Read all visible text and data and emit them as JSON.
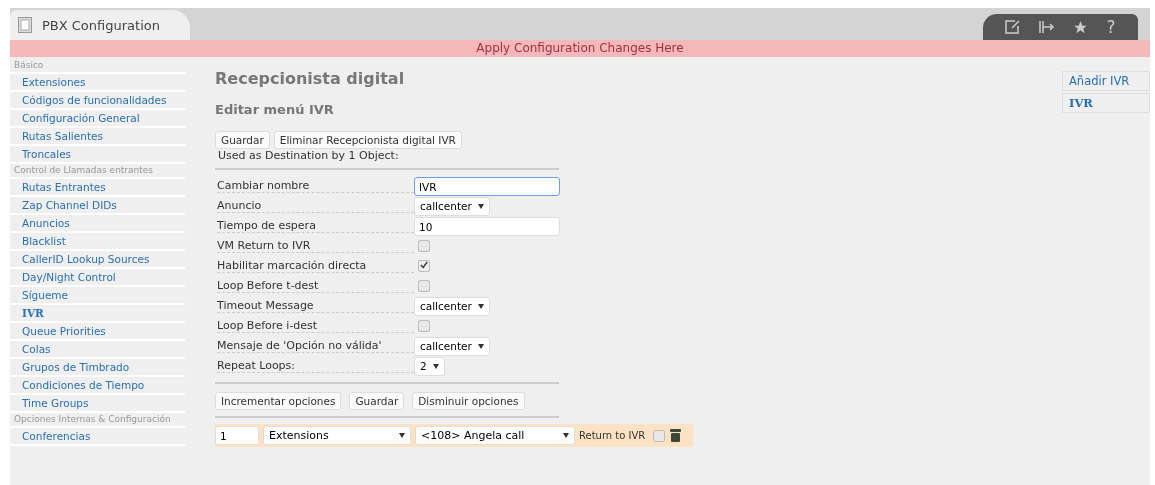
{
  "window": {
    "tab_title": "PBX Configuration",
    "help": "?"
  },
  "banner": "Apply Configuration Changes Here",
  "sidebar": {
    "items": [
      {
        "kind": "header",
        "label": "Básico"
      },
      {
        "kind": "link",
        "label": "Extensiones",
        "selected": false
      },
      {
        "kind": "link",
        "label": "Códigos de funcionalidades",
        "selected": false
      },
      {
        "kind": "link",
        "label": "Configuración General",
        "selected": false
      },
      {
        "kind": "link",
        "label": "Rutas Salientes",
        "selected": false
      },
      {
        "kind": "link",
        "label": "Troncales",
        "selected": false
      },
      {
        "kind": "header",
        "label": "Control de Llamadas entrantes"
      },
      {
        "kind": "link",
        "label": "Rutas Entrantes",
        "selected": false
      },
      {
        "kind": "link",
        "label": "Zap Channel DIDs",
        "selected": false
      },
      {
        "kind": "link",
        "label": "Anuncios",
        "selected": false
      },
      {
        "kind": "link",
        "label": "Blacklist",
        "selected": false
      },
      {
        "kind": "link",
        "label": "CallerID Lookup Sources",
        "selected": false
      },
      {
        "kind": "link",
        "label": "Day/Night Control",
        "selected": false
      },
      {
        "kind": "link",
        "label": "Sígueme",
        "selected": false
      },
      {
        "kind": "link",
        "label": "IVR",
        "selected": true
      },
      {
        "kind": "link",
        "label": "Queue Priorities",
        "selected": false
      },
      {
        "kind": "link",
        "label": "Colas",
        "selected": false
      },
      {
        "kind": "link",
        "label": "Grupos de Timbrado",
        "selected": false
      },
      {
        "kind": "link",
        "label": "Condiciones de Tiempo",
        "selected": false
      },
      {
        "kind": "link",
        "label": "Time Groups",
        "selected": false
      },
      {
        "kind": "header",
        "label": "Opciones Internas & Configuración"
      },
      {
        "kind": "link",
        "label": "Conferencias",
        "selected": false
      }
    ]
  },
  "page": {
    "title": "Recepcionista digital",
    "subtitle": "Editar menú IVR",
    "top_buttons": [
      "Guardar",
      "Eliminar Recepcionista digital IVR"
    ],
    "used_as": "Used as Destination by 1 Object:",
    "fields": [
      {
        "kind": "text",
        "label": "Cambiar nombre",
        "value": "IVR",
        "focused": true
      },
      {
        "kind": "select",
        "label": "Anuncio",
        "value": "callcenter"
      },
      {
        "kind": "text",
        "label": "Tiempo de espera",
        "value": "10",
        "focused": false
      },
      {
        "kind": "checkbox",
        "label": "VM Return to IVR",
        "checked": false
      },
      {
        "kind": "checkbox",
        "label": "Habilitar marcación directa",
        "checked": true
      },
      {
        "kind": "checkbox",
        "label": "Loop Before t-dest",
        "checked": false
      },
      {
        "kind": "select",
        "label": "Timeout Message",
        "value": "callcenter"
      },
      {
        "kind": "checkbox",
        "label": "Loop Before i-dest",
        "checked": false
      },
      {
        "kind": "select",
        "label": "Mensaje de 'Opción no válida'",
        "value": "callcenter"
      },
      {
        "kind": "select",
        "label": "Repeat Loops:",
        "value": "2"
      }
    ],
    "option_buttons": [
      "Incrementar opciones",
      "Guardar",
      "Disminuir opciones"
    ],
    "option_row": {
      "digit": "1",
      "type": "Extensions",
      "destination": "<108> Angela call",
      "return_label": "Return to IVR",
      "return_checked": false
    }
  },
  "right_panel": {
    "items": [
      {
        "label": "Añadir IVR",
        "selected": false
      },
      {
        "label": "IVR",
        "selected": true
      }
    ]
  }
}
